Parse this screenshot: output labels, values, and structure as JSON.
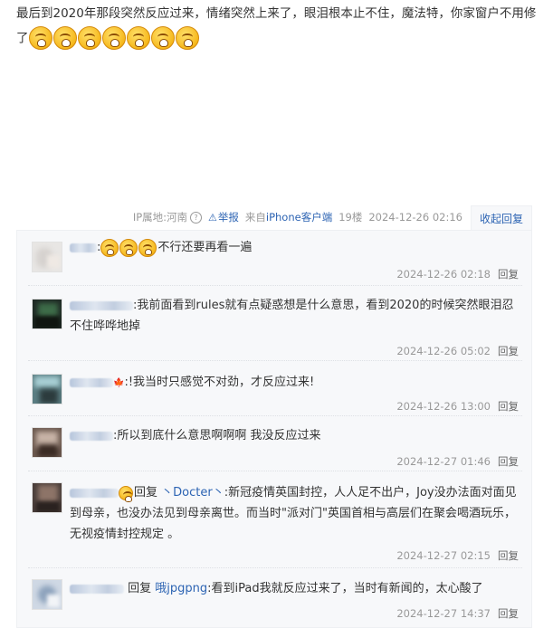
{
  "post": {
    "text": "最后到2020年那段突然反应过来，情绪突然上来了，眼泪根本止不住，魔法特，你家窗户不用修了",
    "emoji_icon": "crying-face-emoji",
    "emoji_count": 7
  },
  "meta": {
    "ip_location": "IP属地:河南",
    "report": "举报",
    "source_prefix": "来自",
    "source_client": "iPhone客户端",
    "floor": "19楼",
    "time": "2024-12-26 02:16",
    "collapse_reply": "收起回复"
  },
  "replies": [
    {
      "name_suffix": ":",
      "text": "不行还要再看一遍",
      "emoji_count": 3,
      "time": "2024-12-26 02:18",
      "reply_label": "回复"
    },
    {
      "name_suffix": ":",
      "text": "我前面看到rules就有点疑惑想是什么意思，看到2020的时候突然眼泪忍不住哗哗地掉",
      "time": "2024-12-26 05:02",
      "reply_label": "回复"
    },
    {
      "name_suffix": ":",
      "text": "!我当时只感觉不对劲，才反应过来!",
      "time": "2024-12-26 13:00",
      "reply_label": "回复"
    },
    {
      "name_suffix": ":",
      "text": "所以到底什么意思啊啊啊 我没反应过来",
      "time": "2024-12-27 01:46",
      "reply_label": "回复"
    },
    {
      "prefix": "回复",
      "target": "丶Docter丶",
      "name_suffix": ":",
      "text": "新冠疫情英国封控，人人足不出户，Joy没办法面对面见到母亲，也没办法见到母亲离世。而当时\"派对门\"英国首相与高层们在聚会喝酒玩乐，无视疫情封控规定 。",
      "time": "2024-12-27 02:15",
      "reply_label": "回复"
    },
    {
      "prefix": "回复",
      "target": "哦jpgpng",
      "name_suffix": ":",
      "text": "看到iPad我就反应过来了，当时有新闻的，太心酸了",
      "time": "2024-12-27 14:37",
      "reply_label": "回复"
    }
  ],
  "colors": {
    "link": "#2d64b3",
    "muted": "#999999",
    "reply_bg": "#f7f8fa"
  }
}
